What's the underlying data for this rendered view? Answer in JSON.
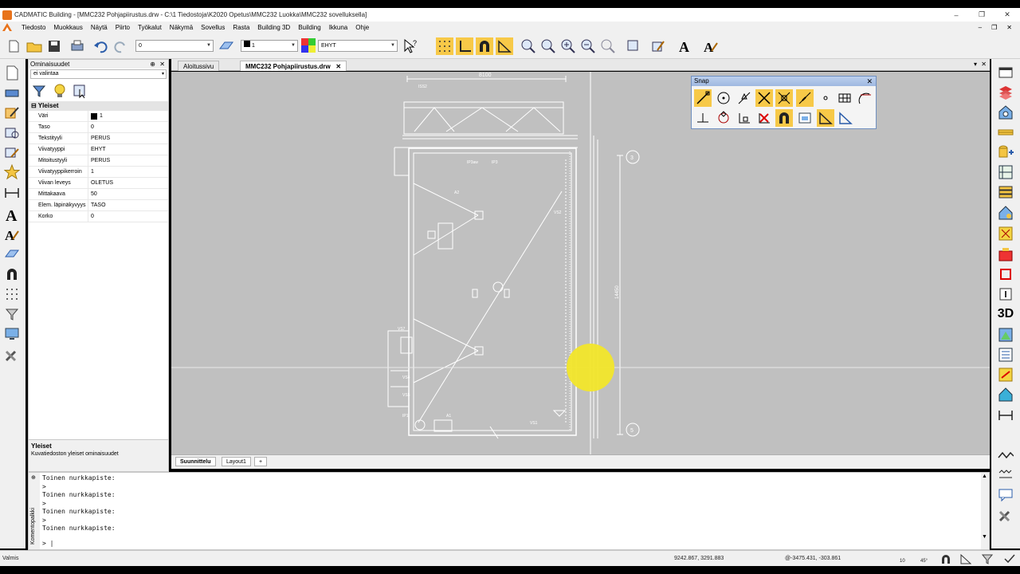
{
  "window": {
    "title": "CADMATIC Building - [MMC232 Pohjapiirustus.drw - C:\\1 Tiedostoja\\K2020 Opetus\\MMC232 Luokka\\MMC232 sovelluksella]",
    "minimize": "–",
    "maximize": "❐",
    "close": "✕"
  },
  "menu": {
    "items": [
      "Tiedosto",
      "Muokkaus",
      "Näytä",
      "Piirto",
      "Työkalut",
      "Näkymä",
      "Sovellus",
      "Rasta",
      "Building 3D",
      "Building",
      "Ikkuna",
      "Ohje"
    ],
    "mdi_min": "–",
    "mdi_restore": "❐",
    "mdi_close": "✕"
  },
  "toolbar": {
    "layer_value": "0",
    "color_value": "1",
    "linetype_value": "EHYT"
  },
  "properties": {
    "title": "Ominaisuudet",
    "pin": "⊕",
    "close": "✕",
    "selection": "ei valintaa",
    "section": "Yleiset",
    "rows": [
      {
        "key": "Väri",
        "value": "1"
      },
      {
        "key": "Taso",
        "value": "0"
      },
      {
        "key": "Tekstityyli",
        "value": "PERUS"
      },
      {
        "key": "Viivatyyppi",
        "value": "EHYT"
      },
      {
        "key": "Mitoitustyyli",
        "value": "PERUS"
      },
      {
        "key": "Viivatyyppikerroin",
        "value": "1"
      },
      {
        "key": "Viivan leveys",
        "value": "OLETUS"
      },
      {
        "key": "Mittakaava",
        "value": "50"
      },
      {
        "key": "Elem. läpinäkyvyys",
        "value": "TASO"
      },
      {
        "key": "Korko",
        "value": "0"
      }
    ],
    "desc_title": "Yleiset",
    "desc_text": "Kuvatiedoston yleiset ominaisuudet"
  },
  "doc_tabs": [
    {
      "label": "Aloitussivu",
      "active": false
    },
    {
      "label": "MMC232 Pohjapiirustus.drw",
      "active": true,
      "close": "✕"
    }
  ],
  "doc_tab_controls": {
    "dropdown": "▾",
    "close": "✕"
  },
  "drawing": {
    "dim_top": "8100",
    "dim_right": "14450",
    "grid_labels": [
      "3",
      "5"
    ],
    "room_labels": [
      "IP3aw",
      "IP3",
      "VS2",
      "VS7",
      "VS4",
      "VS5",
      "A1",
      "A2",
      "VS1",
      "IP1",
      "ISS2"
    ]
  },
  "snap": {
    "title": "Snap",
    "close": "✕"
  },
  "layout_tabs": [
    "Suunnittelu",
    "Layout1",
    "+"
  ],
  "command": {
    "side_label": "Komentopalkki",
    "lines": [
      "Toinen nurkkapiste:",
      ">",
      "Toinen nurkkapiste:",
      ">",
      "Toinen nurkkapiste:",
      ">",
      "Toinen nurkkapiste:"
    ],
    "prompt": "> |"
  },
  "status": {
    "left": "Valmis",
    "coords": "9242.867, 3291.883",
    "rel_coords": "@-3475.431, -303.861",
    "grid": "10",
    "angle": "45°"
  },
  "colors": {
    "canvas_bg": "#c0c0c0",
    "drawing_lines": "#ffffff",
    "highlight": "#f7c948",
    "cursor_marker": "#f2e62a"
  }
}
